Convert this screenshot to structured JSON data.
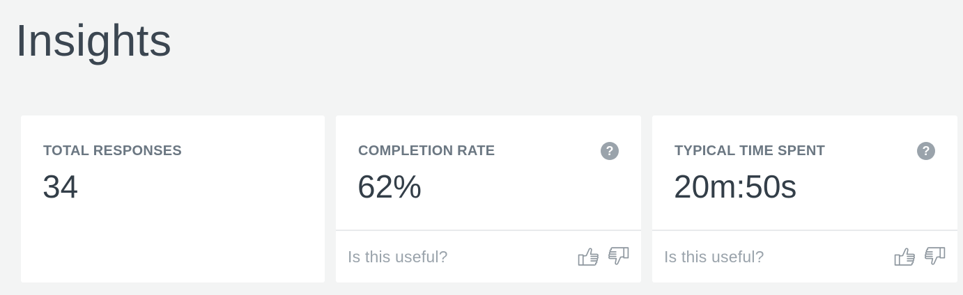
{
  "header": {
    "title": "Insights"
  },
  "cards": [
    {
      "label": "TOTAL RESPONSES",
      "value": "34"
    },
    {
      "label": "COMPLETION RATE",
      "value": "62%",
      "help": "?",
      "feedback_prompt": "Is this useful?"
    },
    {
      "label": "TYPICAL TIME SPENT",
      "value": "20m:50s",
      "help": "?",
      "feedback_prompt": "Is this useful?"
    }
  ],
  "icons": {
    "help": "question-circle-icon",
    "thumbs_up": "thumbs-up-icon",
    "thumbs_down": "thumbs-down-icon"
  },
  "colors": {
    "background": "#f3f4f4",
    "card": "#ffffff",
    "label": "#6b7782",
    "value": "#333e48",
    "muted": "#9aa3ab"
  }
}
